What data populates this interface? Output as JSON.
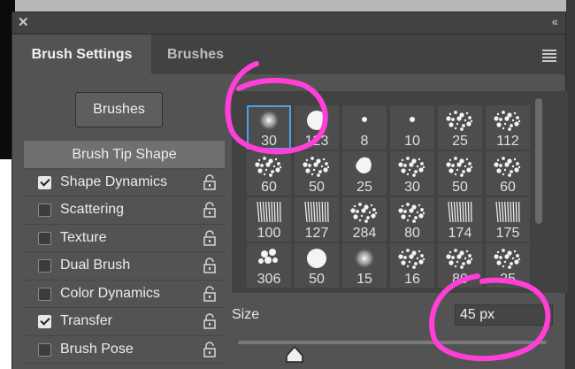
{
  "panel": {
    "close_glyph": "✕",
    "collapse_glyph": "‹‹",
    "tabs": [
      {
        "label": "Brush Settings"
      },
      {
        "label": "Brushes"
      }
    ]
  },
  "brushes_button": "Brushes",
  "options": {
    "header": "Brush Tip Shape",
    "items": [
      {
        "label": "Shape Dynamics",
        "checked": true
      },
      {
        "label": "Scattering",
        "checked": false
      },
      {
        "label": "Texture",
        "checked": false
      },
      {
        "label": "Dual Brush",
        "checked": false
      },
      {
        "label": "Color Dynamics",
        "checked": false
      },
      {
        "label": "Transfer",
        "checked": true
      },
      {
        "label": "Brush Pose",
        "checked": false
      }
    ]
  },
  "brush_presets": [
    {
      "size": "30",
      "tip": "soft-round-icon",
      "selected": true
    },
    {
      "size": "123",
      "tip": "hard-round-icon"
    },
    {
      "size": "8",
      "tip": "small-dot-icon"
    },
    {
      "size": "10",
      "tip": "small-dot-icon"
    },
    {
      "size": "25",
      "tip": "splatter-icon"
    },
    {
      "size": "112",
      "tip": "texture-icon"
    },
    {
      "size": "60",
      "tip": "chalk-icon"
    },
    {
      "size": "50",
      "tip": "chalk-icon"
    },
    {
      "size": "25",
      "tip": "blob-icon"
    },
    {
      "size": "30",
      "tip": "spray-icon"
    },
    {
      "size": "50",
      "tip": "spray-icon"
    },
    {
      "size": "60",
      "tip": "spray-icon"
    },
    {
      "size": "100",
      "tip": "bristle-icon"
    },
    {
      "size": "127",
      "tip": "bristle-icon"
    },
    {
      "size": "284",
      "tip": "scatter-icon"
    },
    {
      "size": "80",
      "tip": "scatter-icon"
    },
    {
      "size": "174",
      "tip": "bristle-icon"
    },
    {
      "size": "175",
      "tip": "bristle-icon"
    },
    {
      "size": "306",
      "tip": "leaf-icon"
    },
    {
      "size": "50",
      "tip": "hard-round-icon"
    },
    {
      "size": "15",
      "tip": "soft-round-icon"
    },
    {
      "size": "16",
      "tip": "scatter-icon"
    },
    {
      "size": "80",
      "tip": "scatter-icon"
    },
    {
      "size": "25",
      "tip": "scatter-icon"
    }
  ],
  "size": {
    "label": "Size",
    "value": "45 px",
    "slider_fraction": 0.22
  },
  "colors": {
    "panel_bg": "#535353",
    "selection": "#4aa3e8",
    "annotation": "#ff3fd8"
  }
}
